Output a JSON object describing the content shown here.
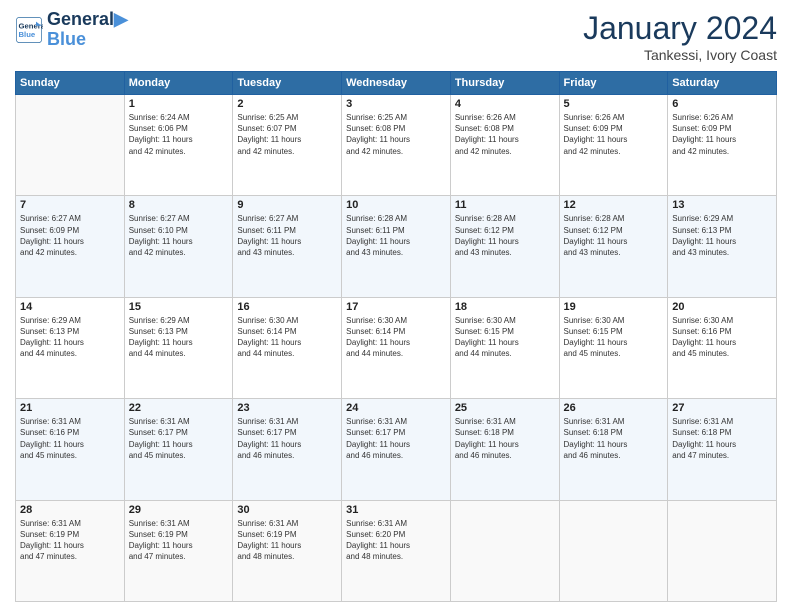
{
  "logo": {
    "line1": "General",
    "line2": "Blue"
  },
  "title": "January 2024",
  "subtitle": "Tankessi, Ivory Coast",
  "days_header": [
    "Sunday",
    "Monday",
    "Tuesday",
    "Wednesday",
    "Thursday",
    "Friday",
    "Saturday"
  ],
  "weeks": [
    [
      {
        "num": "",
        "info": ""
      },
      {
        "num": "1",
        "info": "Sunrise: 6:24 AM\nSunset: 6:06 PM\nDaylight: 11 hours\nand 42 minutes."
      },
      {
        "num": "2",
        "info": "Sunrise: 6:25 AM\nSunset: 6:07 PM\nDaylight: 11 hours\nand 42 minutes."
      },
      {
        "num": "3",
        "info": "Sunrise: 6:25 AM\nSunset: 6:08 PM\nDaylight: 11 hours\nand 42 minutes."
      },
      {
        "num": "4",
        "info": "Sunrise: 6:26 AM\nSunset: 6:08 PM\nDaylight: 11 hours\nand 42 minutes."
      },
      {
        "num": "5",
        "info": "Sunrise: 6:26 AM\nSunset: 6:09 PM\nDaylight: 11 hours\nand 42 minutes."
      },
      {
        "num": "6",
        "info": "Sunrise: 6:26 AM\nSunset: 6:09 PM\nDaylight: 11 hours\nand 42 minutes."
      }
    ],
    [
      {
        "num": "7",
        "info": "Sunrise: 6:27 AM\nSunset: 6:09 PM\nDaylight: 11 hours\nand 42 minutes."
      },
      {
        "num": "8",
        "info": "Sunrise: 6:27 AM\nSunset: 6:10 PM\nDaylight: 11 hours\nand 42 minutes."
      },
      {
        "num": "9",
        "info": "Sunrise: 6:27 AM\nSunset: 6:11 PM\nDaylight: 11 hours\nand 43 minutes."
      },
      {
        "num": "10",
        "info": "Sunrise: 6:28 AM\nSunset: 6:11 PM\nDaylight: 11 hours\nand 43 minutes."
      },
      {
        "num": "11",
        "info": "Sunrise: 6:28 AM\nSunset: 6:12 PM\nDaylight: 11 hours\nand 43 minutes."
      },
      {
        "num": "12",
        "info": "Sunrise: 6:28 AM\nSunset: 6:12 PM\nDaylight: 11 hours\nand 43 minutes."
      },
      {
        "num": "13",
        "info": "Sunrise: 6:29 AM\nSunset: 6:13 PM\nDaylight: 11 hours\nand 43 minutes."
      }
    ],
    [
      {
        "num": "14",
        "info": "Sunrise: 6:29 AM\nSunset: 6:13 PM\nDaylight: 11 hours\nand 44 minutes."
      },
      {
        "num": "15",
        "info": "Sunrise: 6:29 AM\nSunset: 6:13 PM\nDaylight: 11 hours\nand 44 minutes."
      },
      {
        "num": "16",
        "info": "Sunrise: 6:30 AM\nSunset: 6:14 PM\nDaylight: 11 hours\nand 44 minutes."
      },
      {
        "num": "17",
        "info": "Sunrise: 6:30 AM\nSunset: 6:14 PM\nDaylight: 11 hours\nand 44 minutes."
      },
      {
        "num": "18",
        "info": "Sunrise: 6:30 AM\nSunset: 6:15 PM\nDaylight: 11 hours\nand 44 minutes."
      },
      {
        "num": "19",
        "info": "Sunrise: 6:30 AM\nSunset: 6:15 PM\nDaylight: 11 hours\nand 45 minutes."
      },
      {
        "num": "20",
        "info": "Sunrise: 6:30 AM\nSunset: 6:16 PM\nDaylight: 11 hours\nand 45 minutes."
      }
    ],
    [
      {
        "num": "21",
        "info": "Sunrise: 6:31 AM\nSunset: 6:16 PM\nDaylight: 11 hours\nand 45 minutes."
      },
      {
        "num": "22",
        "info": "Sunrise: 6:31 AM\nSunset: 6:17 PM\nDaylight: 11 hours\nand 45 minutes."
      },
      {
        "num": "23",
        "info": "Sunrise: 6:31 AM\nSunset: 6:17 PM\nDaylight: 11 hours\nand 46 minutes."
      },
      {
        "num": "24",
        "info": "Sunrise: 6:31 AM\nSunset: 6:17 PM\nDaylight: 11 hours\nand 46 minutes."
      },
      {
        "num": "25",
        "info": "Sunrise: 6:31 AM\nSunset: 6:18 PM\nDaylight: 11 hours\nand 46 minutes."
      },
      {
        "num": "26",
        "info": "Sunrise: 6:31 AM\nSunset: 6:18 PM\nDaylight: 11 hours\nand 46 minutes."
      },
      {
        "num": "27",
        "info": "Sunrise: 6:31 AM\nSunset: 6:18 PM\nDaylight: 11 hours\nand 47 minutes."
      }
    ],
    [
      {
        "num": "28",
        "info": "Sunrise: 6:31 AM\nSunset: 6:19 PM\nDaylight: 11 hours\nand 47 minutes."
      },
      {
        "num": "29",
        "info": "Sunrise: 6:31 AM\nSunset: 6:19 PM\nDaylight: 11 hours\nand 47 minutes."
      },
      {
        "num": "30",
        "info": "Sunrise: 6:31 AM\nSunset: 6:19 PM\nDaylight: 11 hours\nand 48 minutes."
      },
      {
        "num": "31",
        "info": "Sunrise: 6:31 AM\nSunset: 6:20 PM\nDaylight: 11 hours\nand 48 minutes."
      },
      {
        "num": "",
        "info": ""
      },
      {
        "num": "",
        "info": ""
      },
      {
        "num": "",
        "info": ""
      }
    ]
  ]
}
